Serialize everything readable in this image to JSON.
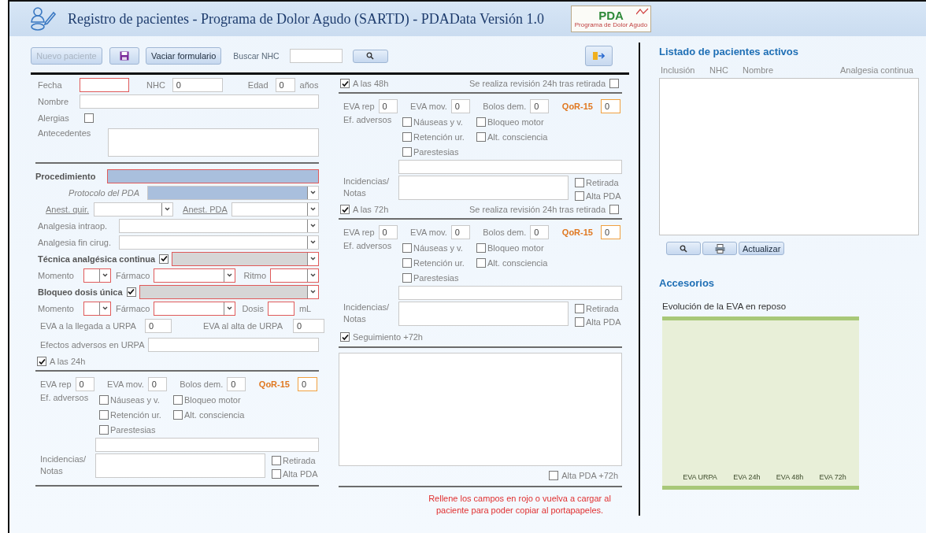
{
  "window": {
    "title": "Registro de pacientes - Programa de Dolor Agudo (SARTD) - PDAData Versión 1.0",
    "logo": {
      "text": "PDA",
      "subtitle": "Programa de Dolor Agudo"
    }
  },
  "toolbar": {
    "new_patient": {
      "label": "Nuevo paciente",
      "disabled": true
    },
    "clear": {
      "label": "Vaciar formulario"
    },
    "search": {
      "label": "Buscar NHC"
    }
  },
  "patient": {
    "fecha": {
      "label": "Fecha",
      "required": true
    },
    "nhc": {
      "label": "NHC",
      "value": "0"
    },
    "edad": {
      "label": "Edad",
      "value": "0",
      "unit": "años"
    },
    "nombre": {
      "label": "Nombre"
    },
    "alergias": {
      "label": "Alergias",
      "checked": false
    },
    "antecedentes": {
      "label": "Antecedentes"
    }
  },
  "procedure": {
    "procedimiento": {
      "label": "Procedimiento",
      "required": true,
      "highlighted": true
    },
    "protocolo": {
      "label": "Protocolo del PDA",
      "highlighted": true
    },
    "anest_quir": {
      "label": "Anest. quir."
    },
    "anest_pda": {
      "label": "Anest. PDA"
    },
    "analgesia_intraop": {
      "label": "Analgesia intraop."
    },
    "analgesia_fin": {
      "label": "Analgesia fin cirug."
    },
    "continua": {
      "label": "Técnica analgésica continua",
      "checked": true,
      "required": true,
      "disabled": true
    },
    "continua_detail": [
      {
        "label": "Momento",
        "required": true
      },
      {
        "label": "Fármaco",
        "required": true
      },
      {
        "label": "Ritmo",
        "required": true
      }
    ],
    "bloqueo": {
      "label": "Bloqueo dosis única",
      "checked": true,
      "required": true,
      "disabled": true
    },
    "bloqueo_detail": [
      {
        "label": "Momento",
        "required": true
      },
      {
        "label": "Fármaco",
        "required": true
      },
      {
        "label": "Dosis",
        "required": true,
        "unit": "mL"
      }
    ],
    "eva_llegada": {
      "label": "EVA a la llegada a URPA",
      "value": "0"
    },
    "eva_alta": {
      "label": "EVA al alta de URPA",
      "value": "0"
    },
    "efectos": {
      "label": "Efectos adversos en URPA"
    }
  },
  "followups": [
    {
      "header": {
        "label": "A las 24h",
        "checked": true
      },
      "scores": [
        {
          "label": "EVA rep",
          "value": "0",
          "kind": "eva"
        },
        {
          "label": "EVA mov.",
          "value": "0",
          "kind": "eva"
        },
        {
          "label": "Bolos dem.",
          "value": "0",
          "kind": "eva"
        },
        {
          "label": "QoR-15",
          "value": "0",
          "kind": "qor"
        }
      ],
      "adverse_label": "Ef. adversos",
      "adverse": [
        {
          "label": "Náuseas y v.",
          "checked": false
        },
        {
          "label": "Bloqueo motor",
          "checked": false
        },
        {
          "label": "Retención ur.",
          "checked": false
        },
        {
          "label": "Alt. consciencia",
          "checked": false
        },
        {
          "label": "Parestesias",
          "checked": false
        }
      ],
      "notes_label": "Incidencias/ Notas",
      "flags": [
        {
          "label": "Retirada",
          "checked": false
        },
        {
          "label": "Alta PDA",
          "checked": false
        }
      ]
    },
    {
      "header": {
        "label": "A las 48h",
        "checked": true
      },
      "review": {
        "label": "Se realiza revisión 24h tras retirada",
        "checked": false
      },
      "scores": [
        {
          "label": "EVA rep",
          "value": "0",
          "kind": "eva"
        },
        {
          "label": "EVA mov.",
          "value": "0",
          "kind": "eva"
        },
        {
          "label": "Bolos dem.",
          "value": "0",
          "kind": "eva"
        },
        {
          "label": "QoR-15",
          "value": "0",
          "kind": "qor"
        }
      ],
      "adverse_label": "Ef. adversos",
      "adverse": [
        {
          "label": "Náuseas y v.",
          "checked": false
        },
        {
          "label": "Bloqueo motor",
          "checked": false
        },
        {
          "label": "Retención ur.",
          "checked": false
        },
        {
          "label": "Alt. consciencia",
          "checked": false
        },
        {
          "label": "Parestesias",
          "checked": false
        }
      ],
      "notes_label": "Incidencias/ Notas",
      "flags": [
        {
          "label": "Retirada",
          "checked": false
        },
        {
          "label": "Alta PDA",
          "checked": false
        }
      ]
    },
    {
      "header": {
        "label": "A las 72h",
        "checked": true
      },
      "review": {
        "label": "Se realiza revisión 24h tras retirada",
        "checked": false
      },
      "scores": [
        {
          "label": "EVA rep",
          "value": "0",
          "kind": "eva"
        },
        {
          "label": "EVA mov.",
          "value": "0",
          "kind": "eva"
        },
        {
          "label": "Bolos dem.",
          "value": "0",
          "kind": "eva"
        },
        {
          "label": "QoR-15",
          "value": "0",
          "kind": "qor"
        }
      ],
      "adverse_label": "Ef. adversos",
      "adverse": [
        {
          "label": "Náuseas y v.",
          "checked": false
        },
        {
          "label": "Bloqueo motor",
          "checked": false
        },
        {
          "label": "Retención ur.",
          "checked": false
        },
        {
          "label": "Alt. consciencia",
          "checked": false
        },
        {
          "label": "Parestesias",
          "checked": false
        }
      ],
      "notes_label": "Incidencias/ Notas",
      "flags": [
        {
          "label": "Retirada",
          "checked": false
        },
        {
          "label": "Alta PDA",
          "checked": false
        }
      ]
    }
  ],
  "seguimiento": {
    "label": "Seguimiento +72h",
    "checked": true,
    "discharge": {
      "label": "Alta PDA +72h",
      "checked": false
    }
  },
  "message": "Rellene los campos en rojo o vuelva a cargar al paciente para poder copiar al portapapeles.",
  "patients_list": {
    "title": "Listado de pacientes activos",
    "columns": [
      "Inclusión",
      "NHC",
      "Nombre",
      "Analgesia continua"
    ],
    "refresh": "Actualizar"
  },
  "accessories": {
    "title": "Accesorios",
    "chart": {
      "title": "Evolución de la EVA en reposo",
      "categories": [
        "EVA URPA",
        "EVA 24h",
        "EVA 48h",
        "EVA 72h"
      ]
    }
  }
}
